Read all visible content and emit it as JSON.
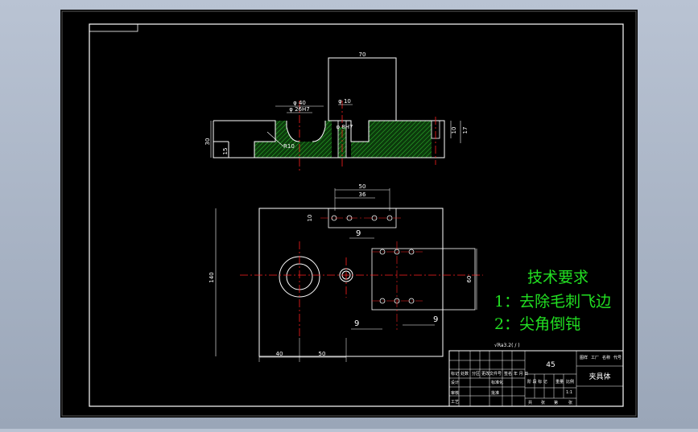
{
  "drawing": {
    "notes": {
      "title": "技术要求",
      "line1": "1：去除毛刺飞边",
      "line2": "2：尖角倒钝"
    },
    "dimensions": {
      "front_top_width": "70",
      "front_bore_dia": "φ 40",
      "front_inner_dia": "φ 26H7",
      "front_small_dia": "φ 10",
      "front_small_hole": "φ 8H7",
      "front_radius": "R10",
      "front_height": "30",
      "front_step": "15",
      "front_right_a": "10",
      "front_right_b": "17",
      "plan_width_a": "50",
      "plan_width_b": "36",
      "plan_offset": "10",
      "plan_height": "140",
      "plan_right_height": "60",
      "plan_bottom_left": "40",
      "plan_bottom_mid": "50",
      "hole_pitch_top": "9",
      "hole_pitch_left": "9",
      "hole_pitch_right": "9"
    },
    "surface_finish": "√Ra3.2(  /  )",
    "title_block": {
      "material": "45",
      "part_name": "夹具体",
      "header_cells": [
        "标记",
        "处数",
        "分区",
        "更改文件号",
        "签名",
        "年 月 日"
      ],
      "row_labels": [
        "设计",
        "审核",
        "工艺"
      ],
      "mid_labels": [
        "标准化",
        "批准"
      ],
      "stage_labels": [
        "阶 段 标 记",
        "重量",
        "比例"
      ],
      "scale": "1:1",
      "sheet_labels": [
        "共",
        "张",
        "第",
        "张"
      ],
      "unit_labels": [
        "图样",
        "工厂",
        "名称",
        "代号"
      ]
    }
  }
}
